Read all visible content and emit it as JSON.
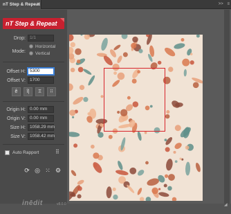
{
  "panel": {
    "tab_title": "nT Step & Repeat",
    "tab_close": "×",
    "tab_menu": ">>",
    "tab_options": "≡",
    "logo_text": "nT Step & Repeat"
  },
  "drop": {
    "label": "Drop:",
    "value": "1/1"
  },
  "mode": {
    "label": "Mode:",
    "options": [
      "Horizontal",
      "Vertical"
    ],
    "selected": "Horizontal"
  },
  "offset": {
    "h_label": "Offset H:",
    "h_value": "5300",
    "v_label": "Offset V:",
    "v_value": "1700"
  },
  "tools": [
    "ê",
    "î|",
    "Ξ",
    "⁝⁝"
  ],
  "origin": {
    "h_label": "Origin H:",
    "h_value": "0.00 mm",
    "v_label": "Origin V:",
    "v_value": "0.00 mm"
  },
  "size": {
    "h_label": "Size H:",
    "h_value": "1058.29 mm",
    "v_label": "Size V:",
    "v_value": "1058.42 mm"
  },
  "auto_rapport": {
    "label": "Auto Rapport",
    "checked": false
  },
  "bottom_icons": [
    "refresh-icon",
    "target-icon",
    "grid-icon",
    "settings-icon"
  ],
  "brand": {
    "name": "inēdit",
    "version": "v8.0.0"
  },
  "colors": {
    "accent": "#c8202f",
    "selection": "#d8232a",
    "pattern_bg": "#f1e3d5"
  }
}
